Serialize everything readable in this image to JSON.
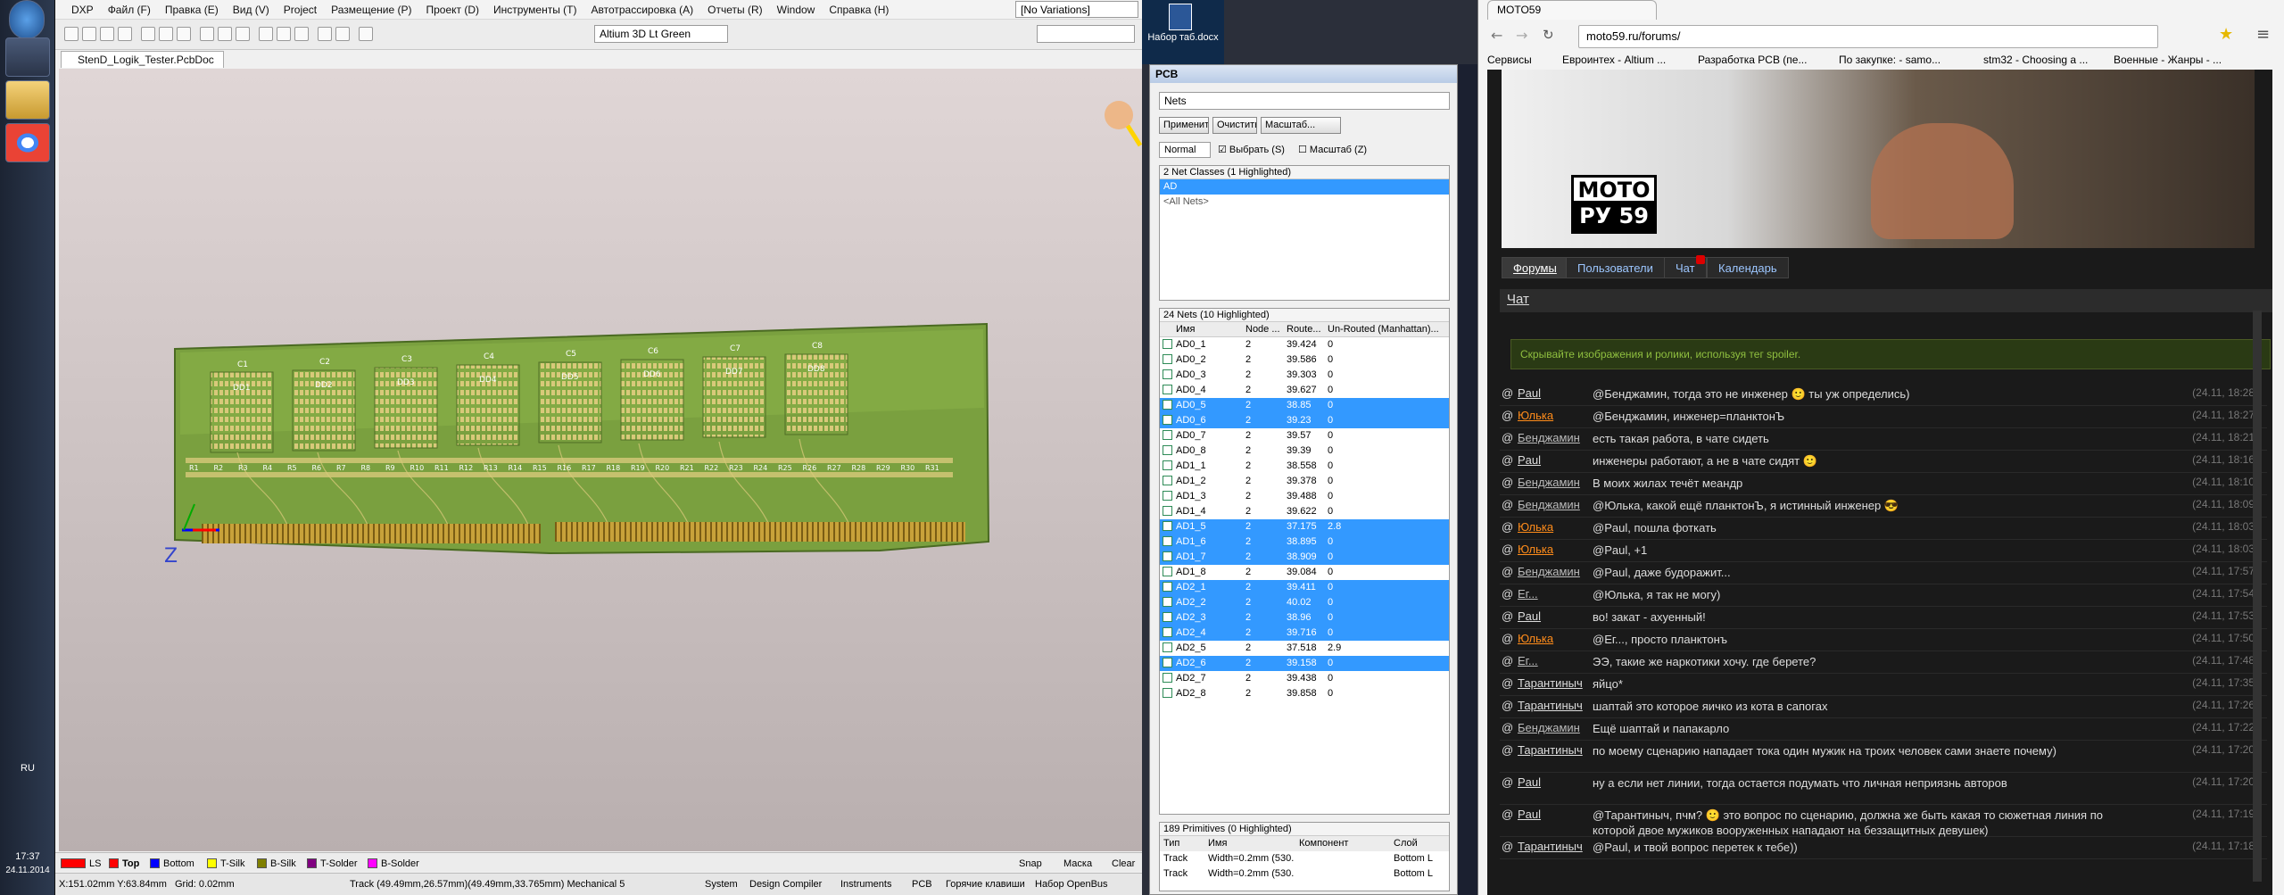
{
  "taskbar": {
    "lang": "RU",
    "time": "17:37",
    "date": "24.11.2014"
  },
  "altium": {
    "menus": [
      "DXP",
      "Файл (F)",
      "Правка (E)",
      "Вид (V)",
      "Project",
      "Размещение (P)",
      "Проект (D)",
      "Инструменты (T)",
      "Автотрассировка (A)",
      "Отчеты (R)",
      "Window",
      "Справка (H)"
    ],
    "variations": "[No Variations]",
    "view_combo": "Altium 3D Lt Green",
    "doc_tab": "StenD_Logik_Tester.PcbDoc",
    "axis_z": "Z",
    "layers": [
      {
        "name": "Top",
        "color": "#ff0000"
      },
      {
        "name": "Bottom",
        "color": "#0000ff"
      },
      {
        "name": "T-Silk",
        "color": "#ffff00"
      },
      {
        "name": "B-Silk",
        "color": "#808000"
      },
      {
        "name": "T-Solder",
        "color": "#800080"
      },
      {
        "name": "B-Solder",
        "color": "#ff00ff"
      }
    ],
    "layer_num": "LS",
    "snap": "Snap",
    "mask": "Маска",
    "clear": "Clear",
    "status": {
      "coords": "X:151.02mm Y:63.84mm",
      "grid": "Grid: 0.02mm",
      "track": "Track (49.49mm,26.57mm)(49.49mm,33.765mm)  Mechanical 5",
      "panels": [
        "System",
        "Design Compiler",
        "Instruments",
        "PCB",
        "Горячие клавиши",
        "Набор OpenBus"
      ]
    },
    "board": {
      "labels_top": [
        "C1",
        "C2",
        "C3",
        "C4",
        "C5",
        "C6",
        "C7",
        "C8"
      ],
      "labels_dd": [
        "DD1",
        "DD2",
        "DD3",
        "DD4",
        "DD5",
        "DD6",
        "DD7",
        "DD8"
      ],
      "labels_r": [
        "R1",
        "R2",
        "R3",
        "R4",
        "R5",
        "R6",
        "R7",
        "R8",
        "R9",
        "R10",
        "R11",
        "R12",
        "R13",
        "R14",
        "R15",
        "R16",
        "R17",
        "R18",
        "R19",
        "R20",
        "R21",
        "R22",
        "R23",
        "R24",
        "R25",
        "R26",
        "R27",
        "R28",
        "R29",
        "R30",
        "R31"
      ]
    }
  },
  "desktop": {
    "icon_label": "Набор таб.docx"
  },
  "pcb": {
    "title": "PCB",
    "mode": "Nets",
    "btn_apply": "Применить",
    "btn_clear": "Очистить",
    "btn_zoom": "Масштаб...",
    "normal": "Normal",
    "chk_select": "Выбрать (S)",
    "chk_zoom": "Масштаб (Z)",
    "classes_header": "2 Net Classes (1 Highlighted)",
    "classes": [
      "AD",
      "<All Nets>"
    ],
    "nets_header": "24 Nets (10 Highlighted)",
    "cols": [
      "Имя",
      "Node ...",
      "Route...",
      "Un-Routed (Manhattan)..."
    ],
    "nets": [
      {
        "n": "AD0_1",
        "c": "2",
        "r": "39.424",
        "u": "0",
        "h": false
      },
      {
        "n": "AD0_2",
        "c": "2",
        "r": "39.586",
        "u": "0",
        "h": false
      },
      {
        "n": "AD0_3",
        "c": "2",
        "r": "39.303",
        "u": "0",
        "h": false
      },
      {
        "n": "AD0_4",
        "c": "2",
        "r": "39.627",
        "u": "0",
        "h": false
      },
      {
        "n": "AD0_5",
        "c": "2",
        "r": "38.85",
        "u": "0",
        "h": true
      },
      {
        "n": "AD0_6",
        "c": "2",
        "r": "39.23",
        "u": "0",
        "h": true
      },
      {
        "n": "AD0_7",
        "c": "2",
        "r": "39.57",
        "u": "0",
        "h": false
      },
      {
        "n": "AD0_8",
        "c": "2",
        "r": "39.39",
        "u": "0",
        "h": false
      },
      {
        "n": "AD1_1",
        "c": "2",
        "r": "38.558",
        "u": "0",
        "h": false
      },
      {
        "n": "AD1_2",
        "c": "2",
        "r": "39.378",
        "u": "0",
        "h": false
      },
      {
        "n": "AD1_3",
        "c": "2",
        "r": "39.488",
        "u": "0",
        "h": false
      },
      {
        "n": "AD1_4",
        "c": "2",
        "r": "39.622",
        "u": "0",
        "h": false
      },
      {
        "n": "AD1_5",
        "c": "2",
        "r": "37.175",
        "u": "2.8",
        "h": true
      },
      {
        "n": "AD1_6",
        "c": "2",
        "r": "38.895",
        "u": "0",
        "h": true
      },
      {
        "n": "AD1_7",
        "c": "2",
        "r": "38.909",
        "u": "0",
        "h": true
      },
      {
        "n": "AD1_8",
        "c": "2",
        "r": "39.084",
        "u": "0",
        "h": false
      },
      {
        "n": "AD2_1",
        "c": "2",
        "r": "39.411",
        "u": "0",
        "h": true
      },
      {
        "n": "AD2_2",
        "c": "2",
        "r": "40.02",
        "u": "0",
        "h": true
      },
      {
        "n": "AD2_3",
        "c": "2",
        "r": "38.96",
        "u": "0",
        "h": true
      },
      {
        "n": "AD2_4",
        "c": "2",
        "r": "39.716",
        "u": "0",
        "h": true
      },
      {
        "n": "AD2_5",
        "c": "2",
        "r": "37.518",
        "u": "2.9",
        "h": false
      },
      {
        "n": "AD2_6",
        "c": "2",
        "r": "39.158",
        "u": "0",
        "h": true
      },
      {
        "n": "AD2_7",
        "c": "2",
        "r": "39.438",
        "u": "0",
        "h": false
      },
      {
        "n": "AD2_8",
        "c": "2",
        "r": "39.858",
        "u": "0",
        "h": false
      }
    ],
    "prim_header": "189 Primitives (0 Highlighted)",
    "prim_cols": [
      "Тип",
      "Имя",
      "Компонент",
      "Слой"
    ],
    "prims": [
      {
        "t": "Track",
        "n": "Width=0.2mm (530.",
        "c": "",
        "l": "Bottom L"
      },
      {
        "t": "Track",
        "n": "Width=0.2mm (530.",
        "c": "",
        "l": "Bottom L"
      }
    ]
  },
  "browser": {
    "tab": "MOTO59",
    "url": "moto59.ru/forums/",
    "bookmarks": [
      "Сервисы",
      "Евроинтех - Altium ...",
      "Разработка PCB (пе...",
      "По закупке: - samo...",
      "stm32 - Choosing a ...",
      "Военные - Жанры - ..."
    ],
    "logo_top": "MOTO",
    "logo_bottom": "РУ 59",
    "nav": [
      "Форумы",
      "Пользователи",
      "Чат",
      "Календарь"
    ],
    "chat_title": "Чат",
    "spoiler_note": "Скрывайте изображения и ролики, используя тег spoiler.",
    "messages": [
      {
        "u": "Paul",
        "t": "@Бенджамин, тогда это не инженер 🙂 ты уж определись)",
        "d": "(24.11, 18:28)",
        "c": "#dddddd"
      },
      {
        "u": "Юлька",
        "t": "@Бенджамин, инженер=планктонЪ",
        "d": "(24.11, 18:27)",
        "c": "#ff8c1a"
      },
      {
        "u": "Бенджамин",
        "t": "есть такая работа, в чате сидеть",
        "d": "(24.11, 18:21)",
        "c": "#bbbbbb"
      },
      {
        "u": "Paul",
        "t": "инженеры работают, а не в чате сидят 🙂",
        "d": "(24.11, 18:16)",
        "c": "#dddddd"
      },
      {
        "u": "Бенджамин",
        "t": "В моих жилах течёт меандр",
        "d": "(24.11, 18:10)",
        "c": "#bbbbbb"
      },
      {
        "u": "Бенджамин",
        "t": "@Юлька, какой ещё планктонЪ, я истинный инженер 😎",
        "d": "(24.11, 18:09)",
        "c": "#bbbbbb"
      },
      {
        "u": "Юлька",
        "t": "@Paul, пошла фоткать",
        "d": "(24.11, 18:03)",
        "c": "#ff8c1a"
      },
      {
        "u": "Юлька",
        "t": "@Paul, +1",
        "d": "(24.11, 18:03)",
        "c": "#ff8c1a"
      },
      {
        "u": "Бенджамин",
        "t": "@Paul, даже будоражит...",
        "d": "(24.11, 17:57)",
        "c": "#bbbbbb"
      },
      {
        "u": "Ег...",
        "t": "@Юлька, я так не могу)",
        "d": "(24.11, 17:54)",
        "c": "#bbbbbb"
      },
      {
        "u": "Paul",
        "t": "во! закат - ахуенный!",
        "d": "(24.11, 17:53)",
        "c": "#dddddd"
      },
      {
        "u": "Юлька",
        "t": "@Ег..., просто планктонъ",
        "d": "(24.11, 17:50)",
        "c": "#ff8c1a"
      },
      {
        "u": "Ег...",
        "t": "ЭЭ, такие же наркотики хочу. где берете?",
        "d": "(24.11, 17:48)",
        "c": "#bbbbbb"
      },
      {
        "u": "Тарантиныч",
        "t": "яйцо*",
        "d": "(24.11, 17:35)",
        "c": "#dddddd"
      },
      {
        "u": "Тарантиныч",
        "t": "шаптай это которое яичко из кота в сапогах",
        "d": "(24.11, 17:26)",
        "c": "#dddddd"
      },
      {
        "u": "Бенджамин",
        "t": "Ещё шаптай и папакарло",
        "d": "(24.11, 17:22)",
        "c": "#bbbbbb"
      },
      {
        "u": "Тарантиныч",
        "t": "по моему сценарию нападает тока один мужик на троих человек сами знаете почему)",
        "d": "(24.11, 17:20)",
        "c": "#dddddd"
      },
      {
        "u": "Paul",
        "t": "ну а если нет линии, тогда остается подумать что личная неприязнь авторов",
        "d": "(24.11, 17:20)",
        "c": "#dddddd"
      },
      {
        "u": "Paul",
        "t": "@Тарантиныч, пчм? 🙂 это вопрос по сценарию, должна же быть какая то сюжетная линия по которой двое мужиков вооруженных нападают на беззащитных девушек)",
        "d": "(24.11, 17:19)",
        "c": "#dddddd"
      },
      {
        "u": "Тарантиныч",
        "t": "@Paul, и твой вопрос перетек к тебе))",
        "d": "(24.11, 17:18)",
        "c": "#dddddd"
      }
    ]
  }
}
